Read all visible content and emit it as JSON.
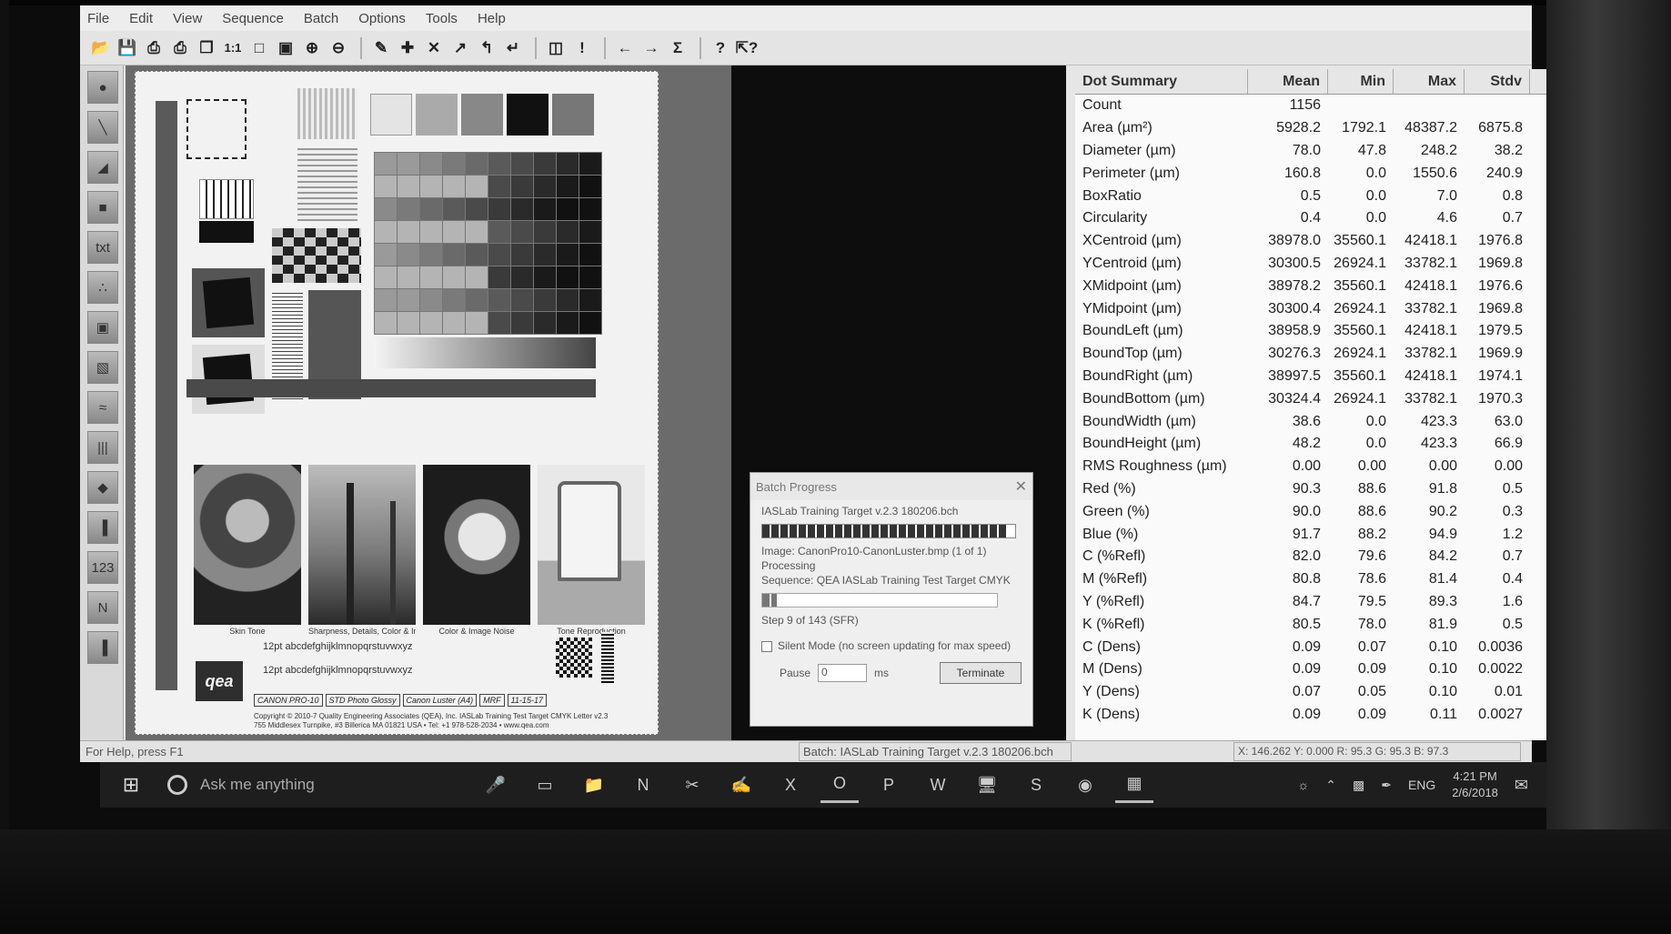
{
  "menu": [
    "File",
    "Edit",
    "View",
    "Sequence",
    "Batch",
    "Options",
    "Tools",
    "Help"
  ],
  "toolbar_icons": [
    "open-icon",
    "save-icon",
    "print-preview-icon",
    "print-icon",
    "copy-icon",
    "actual-size-icon",
    "fit-page-icon",
    "fit-window-icon",
    "zoom-in-icon",
    "zoom-out-icon",
    "measure-icon",
    "add-icon",
    "delete-icon",
    "arrow-icon",
    "tool-icon",
    "tool2-icon",
    "properties-icon",
    "alert-icon",
    "back-icon",
    "forward-icon",
    "sum-icon",
    "help-icon",
    "context-help-icon"
  ],
  "left_tools": [
    "dot-tool",
    "line-tool",
    "edge-tool",
    "area-tool",
    "txt",
    "blob-tool",
    "rect-tool",
    "dark-rect-tool",
    "wave-tool",
    "bars-tool",
    "square-tool",
    "barcode-tool",
    "123-tool",
    "n-tool",
    "column-tool"
  ],
  "target": {
    "photo_captions": [
      "Skin Tone",
      "Sharpness, Details, Color & Image Noise",
      "Color & Image Noise",
      "Tone Reproduction"
    ],
    "logo": "qea",
    "form_values": [
      "CANON PRO-10",
      "STD Photo Glossy",
      "Canon Luster (A4)",
      "MRF",
      "11-15-17"
    ],
    "copyright": "Copyright © 2010-7 Quality Engineering Associates (QEA), Inc. IASLab Training Test Target CMYK Letter v2.3",
    "address": "755 Middlesex Turnpike, #3 Billerica MA 01821 USA • Tel: +1 978-528-2034 • www.qea.com",
    "text_sample_1": "12pt abcdefghijklmnopqrstuvwxyz",
    "text_sample_2": "12pt abcdefghijklmnopqrstuvwxyz"
  },
  "dialog": {
    "title": "Batch Progress",
    "batch_file": "IASLab Training Target v.2.3 180206.bch",
    "image_line": "Image: CanonPro10-CanonLuster.bmp (1 of 1)",
    "processing": "Processing",
    "sequence_line": "Sequence: QEA IASLab Training Test Target CMYK",
    "step_line": "Step 9 of 143 (SFR)",
    "silent_mode": "Silent Mode (no screen updating for max speed)",
    "pause_label": "Pause",
    "pause_value": "0",
    "pause_unit": "ms",
    "terminate": "Terminate",
    "batch_progress": 0.97,
    "step_progress": 0.063
  },
  "summary": {
    "headers": [
      "Dot Summary",
      "Mean",
      "Min",
      "Max",
      "Stdv"
    ],
    "rows": [
      [
        "Count",
        "1156",
        "",
        "",
        ""
      ],
      [
        "Area (µm²)",
        "5928.2",
        "1792.1",
        "48387.2",
        "6875.8"
      ],
      [
        "Diameter (µm)",
        "78.0",
        "47.8",
        "248.2",
        "38.2"
      ],
      [
        "Perimeter (µm)",
        "160.8",
        "0.0",
        "1550.6",
        "240.9"
      ],
      [
        "BoxRatio",
        "0.5",
        "0.0",
        "7.0",
        "0.8"
      ],
      [
        "Circularity",
        "0.4",
        "0.0",
        "4.6",
        "0.7"
      ],
      [
        "XCentroid (µm)",
        "38978.0",
        "35560.1",
        "42418.1",
        "1976.8"
      ],
      [
        "YCentroid (µm)",
        "30300.5",
        "26924.1",
        "33782.1",
        "1969.8"
      ],
      [
        "XMidpoint (µm)",
        "38978.2",
        "35560.1",
        "42418.1",
        "1976.6"
      ],
      [
        "YMidpoint (µm)",
        "30300.4",
        "26924.1",
        "33782.1",
        "1969.8"
      ],
      [
        "BoundLeft (µm)",
        "38958.9",
        "35560.1",
        "42418.1",
        "1979.5"
      ],
      [
        "BoundTop (µm)",
        "30276.3",
        "26924.1",
        "33782.1",
        "1969.9"
      ],
      [
        "BoundRight (µm)",
        "38997.5",
        "35560.1",
        "42418.1",
        "1974.1"
      ],
      [
        "BoundBottom (µm)",
        "30324.4",
        "26924.1",
        "33782.1",
        "1970.3"
      ],
      [
        "BoundWidth (µm)",
        "38.6",
        "0.0",
        "423.3",
        "63.0"
      ],
      [
        "BoundHeight (µm)",
        "48.2",
        "0.0",
        "423.3",
        "66.9"
      ],
      [
        "RMS Roughness (µm)",
        "0.00",
        "0.00",
        "0.00",
        "0.00"
      ],
      [
        "Red (%)",
        "90.3",
        "88.6",
        "91.8",
        "0.5"
      ],
      [
        "Green (%)",
        "90.0",
        "88.6",
        "90.2",
        "0.3"
      ],
      [
        "Blue (%)",
        "91.7",
        "88.2",
        "94.9",
        "1.2"
      ],
      [
        "C (%Refl)",
        "82.0",
        "79.6",
        "84.2",
        "0.7"
      ],
      [
        "M (%Refl)",
        "80.8",
        "78.6",
        "81.4",
        "0.4"
      ],
      [
        "Y (%Refl)",
        "84.7",
        "79.5",
        "89.3",
        "1.6"
      ],
      [
        "K (%Refl)",
        "80.5",
        "78.0",
        "81.9",
        "0.5"
      ],
      [
        "C (Dens)",
        "0.09",
        "0.07",
        "0.10",
        "0.0036"
      ],
      [
        "M (Dens)",
        "0.09",
        "0.09",
        "0.10",
        "0.0022"
      ],
      [
        "Y (Dens)",
        "0.07",
        "0.05",
        "0.10",
        "0.01"
      ],
      [
        "K (Dens)",
        "0.09",
        "0.09",
        "0.11",
        "0.0027"
      ]
    ]
  },
  "status": {
    "help": "For Help, press F1",
    "batch": "Batch: IASLab Training Target v.2.3 180206.bch",
    "coords": "X: 146.262 Y: 0.000 R: 95.3 G: 95.3 B: 97.3"
  },
  "taskbar": {
    "search_placeholder": "Ask me anything",
    "apps": [
      "mic-icon",
      "task-view-icon",
      "file-explorer-icon",
      "app-n-icon",
      "snip-icon",
      "pen-icon",
      "excel-icon",
      "outlook-icon",
      "publisher-icon",
      "word-icon",
      "monitor-icon",
      "s-app-icon",
      "firefox-icon",
      "iaslab-icon"
    ],
    "lang": "ENG",
    "time": "4:21 PM",
    "date": "2/6/2018"
  }
}
